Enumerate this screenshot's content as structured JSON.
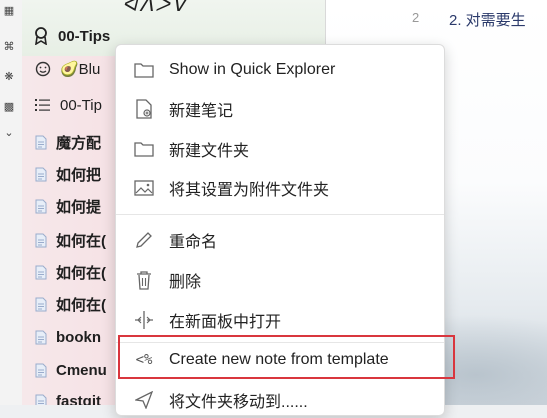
{
  "sidebar": {
    "header_row": {
      "label": "00-Tips",
      "icon": "pin-icon"
    },
    "rows": [
      {
        "label": "🥑Blu",
        "icon": "smiley-icon"
      },
      {
        "label": "00-Tip",
        "icon": "list-icon"
      }
    ],
    "files": [
      "魔方配",
      "如何把",
      "如何提",
      "如何在(",
      "如何在(",
      "如何在(",
      "bookn",
      "Cmenu",
      "fastgit"
    ]
  },
  "editor": {
    "line_number": "2",
    "line_text": "2. 对需要生"
  },
  "context_menu": {
    "items": [
      {
        "label": "Show in Quick Explorer",
        "icon": "folder-icon"
      },
      {
        "label": "新建笔记",
        "icon": "new-note-icon"
      },
      {
        "label": "新建文件夹",
        "icon": "folder-icon"
      },
      {
        "label": "将其设置为附件文件夹",
        "icon": "image-icon"
      },
      {
        "label": "重命名",
        "icon": "pencil-icon"
      },
      {
        "label": "删除",
        "icon": "trash-icon"
      },
      {
        "label": "在新面板中打开",
        "icon": "split-icon"
      },
      {
        "label": "Create new note from template",
        "icon": "template-icon"
      },
      {
        "label": "将文件夹移动到......",
        "icon": "send-icon"
      }
    ]
  },
  "colors": {
    "highlight_border": "#d9363e",
    "sidebar_bg": "#f5dde2"
  }
}
